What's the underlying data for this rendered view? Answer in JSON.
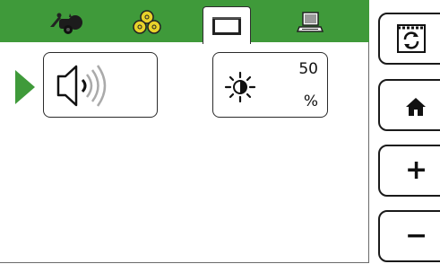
{
  "tabs": [
    {
      "name": "baler",
      "icon": "round-baler-icon",
      "active": false
    },
    {
      "name": "bales",
      "icon": "bale-stack-icon",
      "active": false
    },
    {
      "name": "display",
      "icon": "display-screen-icon",
      "active": true
    },
    {
      "name": "terminal",
      "icon": "laptop-terminal-icon",
      "active": false
    }
  ],
  "settings": {
    "volume": {
      "icon": "speaker-volume-icon"
    },
    "brightness": {
      "icon": "brightness-sun-icon",
      "value": "50",
      "unit": "%"
    }
  },
  "side_buttons": {
    "cycle": {
      "icon": "cycle-arrows-icon"
    },
    "home": {
      "icon": "home-icon"
    },
    "plus": {
      "label": "+"
    },
    "minus": {
      "label": "−"
    }
  },
  "colors": {
    "accent": "#3f9a3a",
    "bale_yellow": "#e8d22a"
  }
}
